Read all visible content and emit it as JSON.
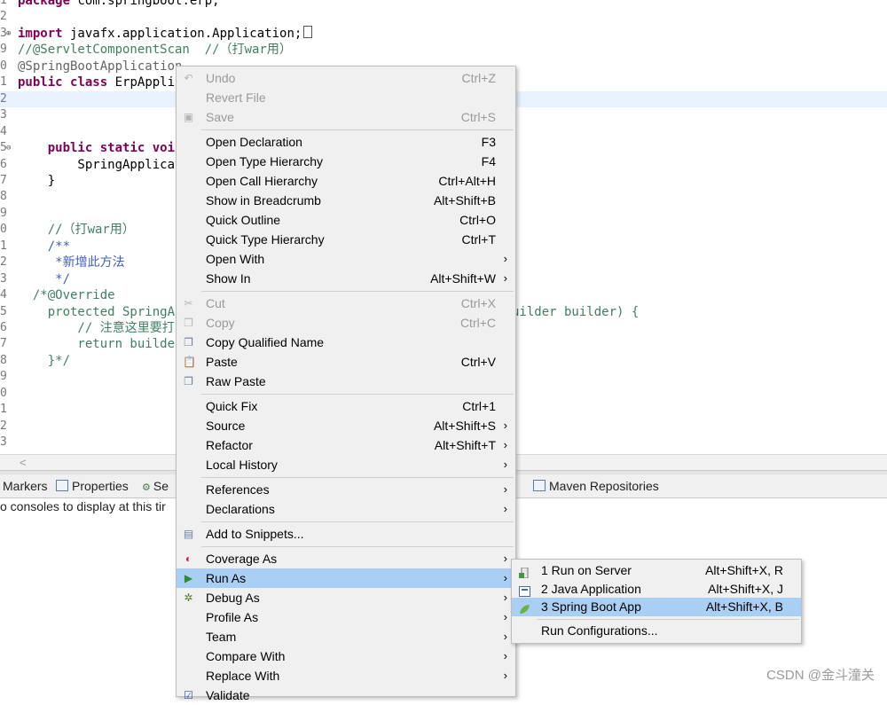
{
  "editor": {
    "lines": [
      {
        "num": "1",
        "parts": [
          {
            "c": "kw",
            "t": "package"
          },
          {
            "c": "tx",
            "t": " com.springboot.erp;"
          }
        ]
      },
      {
        "num": "2",
        "parts": []
      },
      {
        "num": "3",
        "fold": "⊕",
        "parts": [
          {
            "c": "kw",
            "t": "import"
          },
          {
            "c": "tx",
            "t": " javafx.application.Application;"
          }
        ],
        "box": true
      },
      {
        "num": "9",
        "parts": [
          {
            "c": "cm",
            "t": "//@ServletComponentScan  //（打war用）"
          }
        ]
      },
      {
        "num": "0",
        "parts": [
          {
            "c": "an",
            "t": "@SpringBootApplication"
          }
        ]
      },
      {
        "num": "1",
        "parts": [
          {
            "c": "kw",
            "t": "public"
          },
          {
            "c": "tx",
            "t": " "
          },
          {
            "c": "kw",
            "t": "class"
          },
          {
            "c": "tx",
            "t": " ErpAppli"
          }
        ]
      },
      {
        "num": "2",
        "parts": [],
        "current": true
      },
      {
        "num": "3",
        "parts": []
      },
      {
        "num": "4",
        "parts": []
      },
      {
        "num": "5",
        "fold": "⊖",
        "parts": [
          {
            "c": "tx",
            "t": "    "
          },
          {
            "c": "kw",
            "t": "public"
          },
          {
            "c": "tx",
            "t": " "
          },
          {
            "c": "kw",
            "t": "static"
          },
          {
            "c": "tx",
            "t": " "
          },
          {
            "c": "kw",
            "t": "voi"
          }
        ]
      },
      {
        "num": "6",
        "parts": [
          {
            "c": "tx",
            "t": "        SpringApplicat"
          }
        ]
      },
      {
        "num": "7",
        "parts": [
          {
            "c": "tx",
            "t": "    }"
          }
        ]
      },
      {
        "num": "8",
        "parts": []
      },
      {
        "num": "9",
        "parts": []
      },
      {
        "num": "0",
        "parts": [
          {
            "c": "cm",
            "t": "    //（打war用）"
          }
        ]
      },
      {
        "num": "1",
        "parts": [
          {
            "c": "jd",
            "t": "    /**"
          }
        ]
      },
      {
        "num": "2",
        "parts": [
          {
            "c": "jd",
            "t": "     *新增此方法"
          }
        ]
      },
      {
        "num": "3",
        "parts": [
          {
            "c": "jd",
            "t": "     */"
          }
        ]
      },
      {
        "num": "4",
        "parts": [
          {
            "c": "cm",
            "t": "  /*@Override"
          }
        ]
      },
      {
        "num": "5",
        "parts": [
          {
            "c": "cm",
            "t": "    protected SpringAp"
          }
        ],
        "tail": "uilder builder) {"
      },
      {
        "num": "6",
        "parts": [
          {
            "c": "cm",
            "t": "        // 注意这里要打"
          }
        ]
      },
      {
        "num": "7",
        "parts": [
          {
            "c": "cm",
            "t": "        return builde"
          }
        ]
      },
      {
        "num": "8",
        "parts": [
          {
            "c": "cm",
            "t": "    }*/"
          }
        ]
      },
      {
        "num": "9",
        "parts": []
      },
      {
        "num": "0",
        "parts": []
      },
      {
        "num": "1",
        "parts": []
      },
      {
        "num": "2",
        "parts": []
      },
      {
        "num": "3",
        "parts": []
      }
    ],
    "scroll_arrow": "<"
  },
  "bottom_tabs": {
    "markers": "Markers",
    "properties": "Properties",
    "servers_partial": "Se",
    "maven": "Maven Repositories",
    "console_message": "o consoles to display at this tir"
  },
  "context_menu": {
    "items": [
      {
        "label": "Undo",
        "shortcut": "Ctrl+Z",
        "disabled": true,
        "icon": "undo-icon",
        "glyph": "↶"
      },
      {
        "label": "Revert File",
        "disabled": true
      },
      {
        "label": "Save",
        "shortcut": "Ctrl+S",
        "disabled": true,
        "icon": "save-icon",
        "glyph": "▣"
      },
      {
        "sep": true
      },
      {
        "label": "Open Declaration",
        "shortcut": "F3"
      },
      {
        "label": "Open Type Hierarchy",
        "shortcut": "F4"
      },
      {
        "label": "Open Call Hierarchy",
        "shortcut": "Ctrl+Alt+H"
      },
      {
        "label": "Show in Breadcrumb",
        "shortcut": "Alt+Shift+B"
      },
      {
        "label": "Quick Outline",
        "shortcut": "Ctrl+O"
      },
      {
        "label": "Quick Type Hierarchy",
        "shortcut": "Ctrl+T"
      },
      {
        "label": "Open With",
        "submenu": true
      },
      {
        "label": "Show In",
        "shortcut": "Alt+Shift+W",
        "submenu": true
      },
      {
        "sep": true
      },
      {
        "label": "Cut",
        "shortcut": "Ctrl+X",
        "disabled": true,
        "icon": "cut-icon",
        "glyph": "✂"
      },
      {
        "label": "Copy",
        "shortcut": "Ctrl+C",
        "disabled": true,
        "icon": "copy-icon",
        "glyph": "❐"
      },
      {
        "label": "Copy Qualified Name",
        "icon": "copy-qualified-name-icon",
        "glyph": "❐"
      },
      {
        "label": "Paste",
        "shortcut": "Ctrl+V",
        "icon": "paste-icon",
        "glyph": "📋"
      },
      {
        "label": "Raw Paste",
        "icon": "raw-paste-icon",
        "glyph": "❐"
      },
      {
        "sep": true
      },
      {
        "label": "Quick Fix",
        "shortcut": "Ctrl+1"
      },
      {
        "label": "Source",
        "shortcut": "Alt+Shift+S",
        "submenu": true
      },
      {
        "label": "Refactor",
        "shortcut": "Alt+Shift+T",
        "submenu": true
      },
      {
        "label": "Local History",
        "submenu": true
      },
      {
        "sep": true
      },
      {
        "label": "References",
        "submenu": true
      },
      {
        "label": "Declarations",
        "submenu": true
      },
      {
        "sep": true
      },
      {
        "label": "Add to Snippets...",
        "icon": "snippets-icon",
        "glyph": "▤"
      },
      {
        "sep": true
      },
      {
        "label": "Coverage As",
        "submenu": true,
        "icon": "coverage-icon",
        "glyph": "◐"
      },
      {
        "label": "Run As",
        "submenu": true,
        "highlighted": true,
        "icon": "run-icon",
        "glyph": "▶"
      },
      {
        "label": "Debug As",
        "submenu": true,
        "icon": "debug-icon",
        "glyph": "✲"
      },
      {
        "label": "Profile As",
        "submenu": true
      },
      {
        "label": "Team",
        "submenu": true
      },
      {
        "label": "Compare With",
        "submenu": true
      },
      {
        "label": "Replace With",
        "submenu": true
      },
      {
        "label": "Validate",
        "icon": "validate-icon",
        "glyph": "☑"
      }
    ]
  },
  "run_as_submenu": {
    "items": [
      {
        "label": "1 Run on Server",
        "shortcut": "Alt+Shift+X, R",
        "icon": "server-icon"
      },
      {
        "label": "2 Java Application",
        "shortcut": "Alt+Shift+X, J",
        "icon": "java-app-icon"
      },
      {
        "label": "3 Spring Boot App",
        "shortcut": "Alt+Shift+X, B",
        "icon": "spring-boot-icon",
        "highlighted": true
      },
      {
        "sep": true
      },
      {
        "label": "Run Configurations..."
      }
    ]
  },
  "watermark": "CSDN @金斗潼关",
  "colors": {
    "menu_bg": "#f0f0f0",
    "highlight": "#a9cff4",
    "keyword": "#7f0055",
    "comment": "#3f7f5f",
    "javadoc": "#3f5fbf"
  }
}
